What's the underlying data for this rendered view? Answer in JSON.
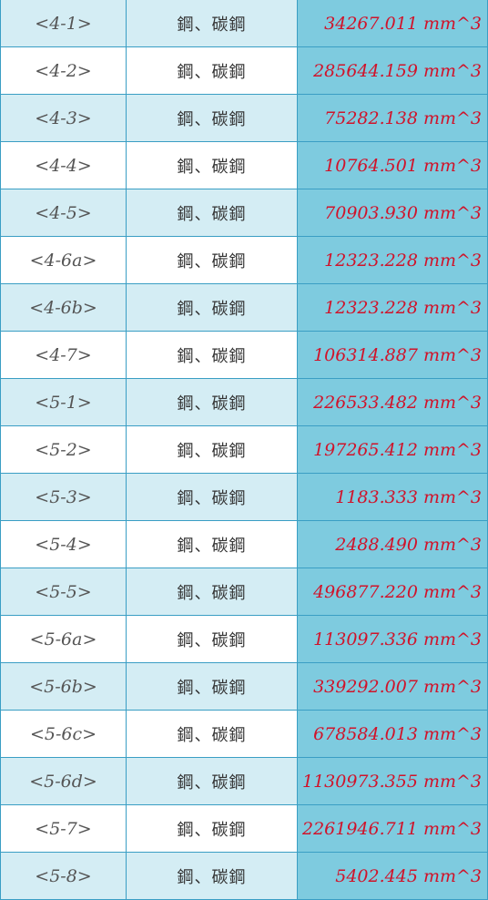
{
  "rows": [
    {
      "id": "<4-1>",
      "material": "鋼、碳鋼",
      "volume": "34267.011 mm^3"
    },
    {
      "id": "<4-2>",
      "material": "鋼、碳鋼",
      "volume": "285644.159 mm^3"
    },
    {
      "id": "<4-3>",
      "material": "鋼、碳鋼",
      "volume": "75282.138 mm^3"
    },
    {
      "id": "<4-4>",
      "material": "鋼、碳鋼",
      "volume": "10764.501 mm^3"
    },
    {
      "id": "<4-5>",
      "material": "鋼、碳鋼",
      "volume": "70903.930 mm^3"
    },
    {
      "id": "<4-6a>",
      "material": "鋼、碳鋼",
      "volume": "12323.228 mm^3"
    },
    {
      "id": "<4-6b>",
      "material": "鋼、碳鋼",
      "volume": "12323.228 mm^3"
    },
    {
      "id": "<4-7>",
      "material": "鋼、碳鋼",
      "volume": "106314.887 mm^3"
    },
    {
      "id": "<5-1>",
      "material": "鋼、碳鋼",
      "volume": "226533.482 mm^3"
    },
    {
      "id": "<5-2>",
      "material": "鋼、碳鋼",
      "volume": "197265.412 mm^3"
    },
    {
      "id": "<5-3>",
      "material": "鋼、碳鋼",
      "volume": "1183.333 mm^3"
    },
    {
      "id": "<5-4>",
      "material": "鋼、碳鋼",
      "volume": "2488.490 mm^3"
    },
    {
      "id": "<5-5>",
      "material": "鋼、碳鋼",
      "volume": "496877.220 mm^3"
    },
    {
      "id": "<5-6a>",
      "material": "鋼、碳鋼",
      "volume": "113097.336 mm^3"
    },
    {
      "id": "<5-6b>",
      "material": "鋼、碳鋼",
      "volume": "339292.007 mm^3"
    },
    {
      "id": "<5-6c>",
      "material": "鋼、碳鋼",
      "volume": "678584.013 mm^3"
    },
    {
      "id": "<5-6d>",
      "material": "鋼、碳鋼",
      "volume": "1130973.355 mm^3"
    },
    {
      "id": "<5-7>",
      "material": "鋼、碳鋼",
      "volume": "2261946.711 mm^3"
    },
    {
      "id": "<5-8>",
      "material": "鋼、碳鋼",
      "volume": "5402.445 mm^3"
    }
  ],
  "colors": {
    "row_odd": "#d4edf4",
    "row_even": "#ffffff",
    "volume_bg": "#7ecbdf",
    "volume_text": "#d0132a",
    "border": "#3a9ec4"
  }
}
